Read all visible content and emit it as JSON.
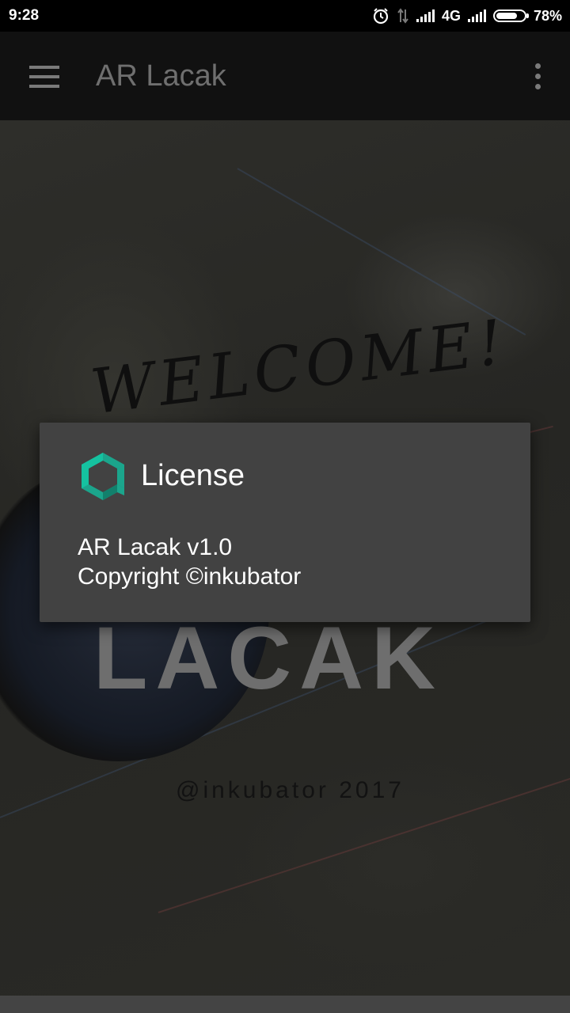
{
  "status_bar": {
    "time": "9:28",
    "network": "4G",
    "battery": "78%",
    "battery_level": 0.78,
    "icons": [
      "alarm-icon",
      "data-transfer-icon",
      "signal-icon",
      "signal-icon",
      "battery-icon"
    ]
  },
  "app_bar": {
    "title": "AR Lacak",
    "nav_icon": "menu-icon",
    "overflow_icon": "more-vert-icon"
  },
  "background": {
    "welcome": "WELCOME!",
    "app_name": "LACAK",
    "credit": "@inkubator 2017"
  },
  "dialog": {
    "icon": "app-logo-icon",
    "title": "License",
    "version_line": "AR Lacak v1.0",
    "copyright_line": "Copyright ©inkubator",
    "accent_color": "#1ba58c"
  }
}
